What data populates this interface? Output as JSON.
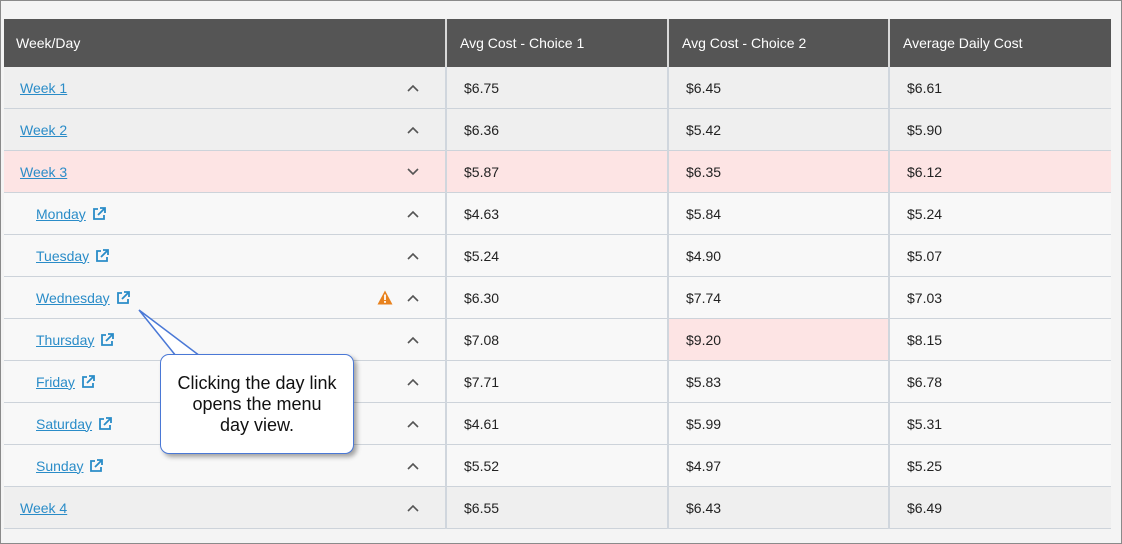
{
  "headers": [
    "Week/Day",
    "Avg Cost - Choice 1",
    "Avg Cost - Choice 2",
    "Average Daily Cost"
  ],
  "rows": [
    {
      "label": "Week 1",
      "c1": "$6.75",
      "c2": "$6.45",
      "c3": "$6.61"
    },
    {
      "label": "Week 2",
      "c1": "$6.36",
      "c2": "$5.42",
      "c3": "$5.90"
    },
    {
      "label": "Week 3",
      "c1": "$5.87",
      "c2": "$6.35",
      "c3": "$6.12"
    },
    {
      "label": "Monday",
      "c1": "$4.63",
      "c2": "$5.84",
      "c3": "$5.24"
    },
    {
      "label": "Tuesday",
      "c1": "$5.24",
      "c2": "$4.90",
      "c3": "$5.07"
    },
    {
      "label": "Wednesday",
      "c1": "$6.30",
      "c2": "$7.74",
      "c3": "$7.03"
    },
    {
      "label": "Thursday",
      "c1": "$7.08",
      "c2": "$9.20",
      "c3": "$8.15"
    },
    {
      "label": "Friday",
      "c1": "$7.71",
      "c2": "$5.83",
      "c3": "$6.78"
    },
    {
      "label": "Saturday",
      "c1": "$4.61",
      "c2": "$5.99",
      "c3": "$5.31"
    },
    {
      "label": "Sunday",
      "c1": "$5.52",
      "c2": "$4.97",
      "c3": "$5.25"
    },
    {
      "label": "Week 4",
      "c1": "$6.55",
      "c2": "$6.43",
      "c3": "$6.49"
    }
  ],
  "callout": {
    "text": "Clicking the day link opens the menu day view."
  },
  "colors": {
    "header_bg": "#555555",
    "link": "#2a8cc8",
    "alert_bg": "#fde4e4",
    "warning": "#e8821e",
    "callout_border": "#4a78d6"
  },
  "icons": {
    "expanded": "chevron-down-icon",
    "collapsed": "chevron-up-icon",
    "external": "external-link-icon",
    "warning": "warning-icon"
  }
}
